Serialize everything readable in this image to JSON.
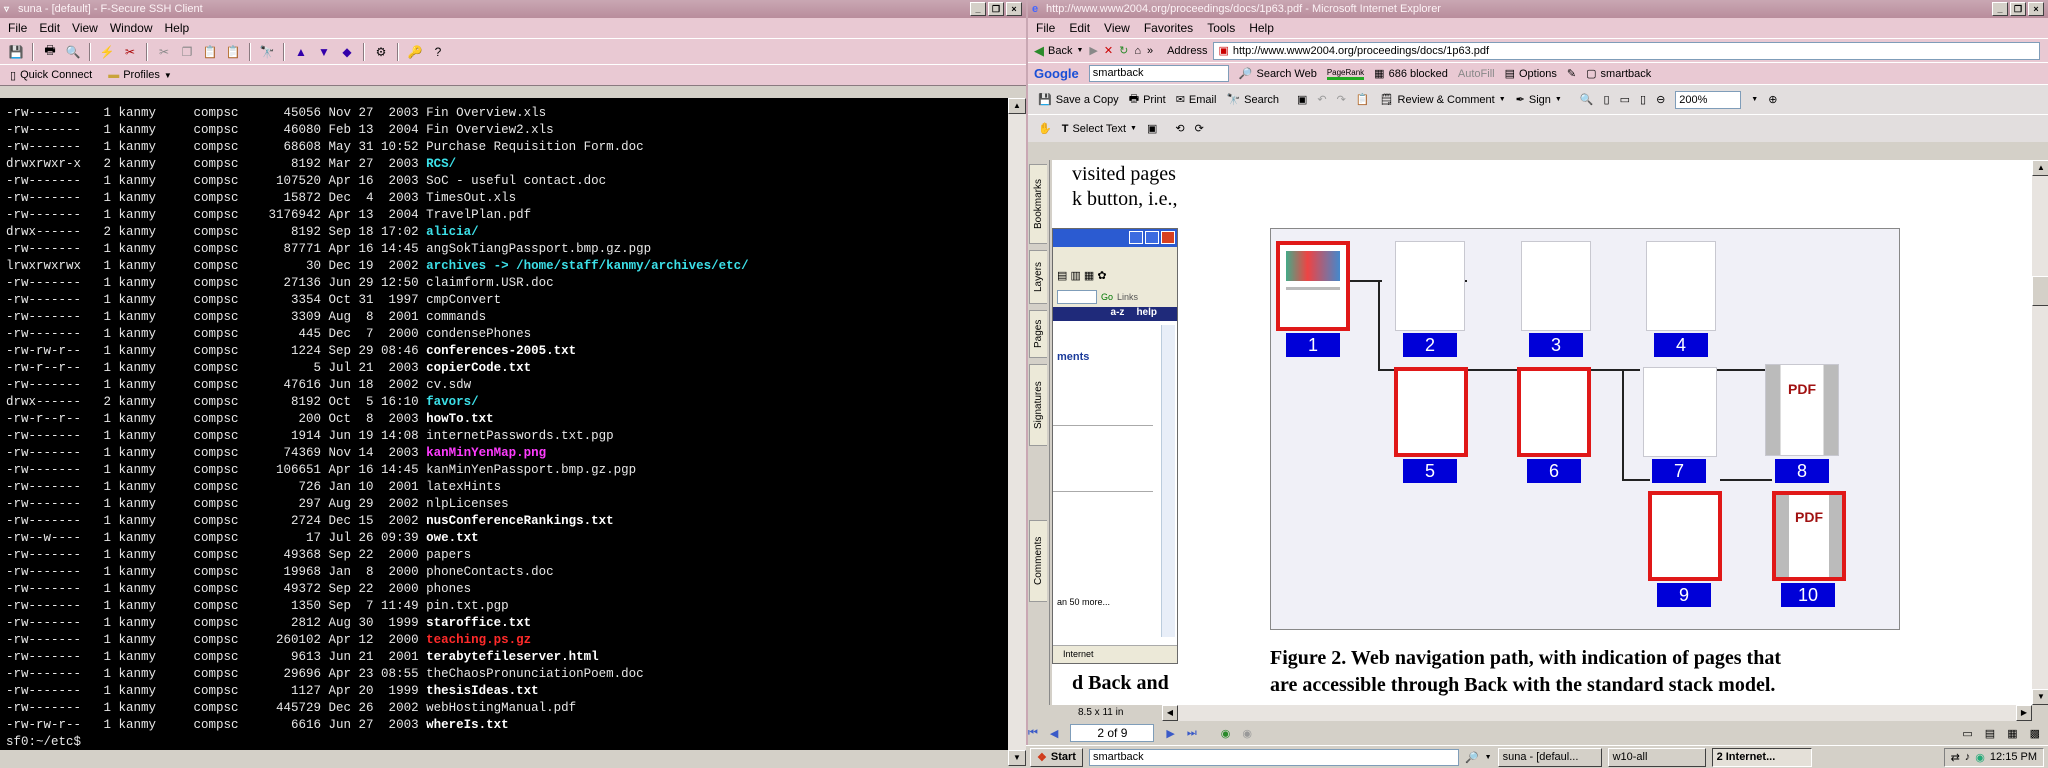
{
  "ssh": {
    "title": "suna - [default] - F-Secure SSH Client",
    "menu": [
      "File",
      "Edit",
      "View",
      "Window",
      "Help"
    ],
    "quick_connect": "Quick Connect",
    "profiles": "Profiles",
    "lines": [
      {
        "meta": "-rw-------   1 kanmy     compsc      45056 Nov 27  2003 ",
        "name": "Fin Overview.xls",
        "style": ""
      },
      {
        "meta": "-rw-------   1 kanmy     compsc      46080 Feb 13  2004 ",
        "name": "Fin Overview2.xls",
        "style": ""
      },
      {
        "meta": "-rw-------   1 kanmy     compsc      68608 May 31 10:52 ",
        "name": "Purchase Requisition Form.doc",
        "style": ""
      },
      {
        "meta": "drwxrwxr-x   2 kanmy     compsc       8192 Mar 27  2003 ",
        "name": "RCS/",
        "style": "cyan"
      },
      {
        "meta": "-rw-------   1 kanmy     compsc     107520 Apr 16  2003 ",
        "name": "SoC - useful contact.doc",
        "style": ""
      },
      {
        "meta": "-rw-------   1 kanmy     compsc      15872 Dec  4  2003 ",
        "name": "TimesOut.xls",
        "style": ""
      },
      {
        "meta": "-rw-------   1 kanmy     compsc    3176942 Apr 13  2004 ",
        "name": "TravelPlan.pdf",
        "style": ""
      },
      {
        "meta": "drwx------   2 kanmy     compsc       8192 Sep 18 17:02 ",
        "name": "alicia/",
        "style": "cyan"
      },
      {
        "meta": "-rw-------   1 kanmy     compsc      87771 Apr 16 14:45 ",
        "name": "angSokTiangPassport.bmp.gz.pgp",
        "style": ""
      },
      {
        "meta": "lrwxrwxrwx   1 kanmy     compsc         30 Dec 19  2002 ",
        "name": "archives -> /home/staff/kanmy/archives/etc/",
        "style": "cyan"
      },
      {
        "meta": "-rw-------   1 kanmy     compsc      27136 Jun 29 12:50 ",
        "name": "claimform.USR.doc",
        "style": ""
      },
      {
        "meta": "-rw-------   1 kanmy     compsc       3354 Oct 31  1997 ",
        "name": "cmpConvert",
        "style": ""
      },
      {
        "meta": "-rw-------   1 kanmy     compsc       3309 Aug  8  2001 ",
        "name": "commands",
        "style": ""
      },
      {
        "meta": "-rw-------   1 kanmy     compsc        445 Dec  7  2000 ",
        "name": "condensePhones",
        "style": ""
      },
      {
        "meta": "-rw-rw-r--   1 kanmy     compsc       1224 Sep 29 08:46 ",
        "name": "conferences-2005.txt",
        "style": "bold"
      },
      {
        "meta": "-rw-r--r--   1 kanmy     compsc          5 Jul 21  2003 ",
        "name": "copierCode.txt",
        "style": "bold"
      },
      {
        "meta": "-rw-------   1 kanmy     compsc      47616 Jun 18  2002 ",
        "name": "cv.sdw",
        "style": ""
      },
      {
        "meta": "drwx------   2 kanmy     compsc       8192 Oct  5 16:10 ",
        "name": "favors/",
        "style": "cyan"
      },
      {
        "meta": "-rw-r--r--   1 kanmy     compsc        200 Oct  8  2003 ",
        "name": "howTo.txt",
        "style": "bold"
      },
      {
        "meta": "-rw-------   1 kanmy     compsc       1914 Jun 19 14:08 ",
        "name": "internetPasswords.txt.pgp",
        "style": ""
      },
      {
        "meta": "-rw-------   1 kanmy     compsc      74369 Nov 14  2003 ",
        "name": "kanMinYenMap.png",
        "style": "mag"
      },
      {
        "meta": "-rw-------   1 kanmy     compsc     106651 Apr 16 14:45 ",
        "name": "kanMinYenPassport.bmp.gz.pgp",
        "style": ""
      },
      {
        "meta": "-rw-------   1 kanmy     compsc        726 Jan 10  2001 ",
        "name": "latexHints",
        "style": ""
      },
      {
        "meta": "-rw-------   1 kanmy     compsc        297 Aug 29  2002 ",
        "name": "nlpLicenses",
        "style": ""
      },
      {
        "meta": "-rw-------   1 kanmy     compsc       2724 Dec 15  2002 ",
        "name": "nusConferenceRankings.txt",
        "style": "bold"
      },
      {
        "meta": "-rw--w----   1 kanmy     compsc         17 Jul 26 09:39 ",
        "name": "owe.txt",
        "style": "bold"
      },
      {
        "meta": "-rw-------   1 kanmy     compsc      49368 Sep 22  2000 ",
        "name": "papers",
        "style": ""
      },
      {
        "meta": "-rw-------   1 kanmy     compsc      19968 Jan  8  2000 ",
        "name": "phoneContacts.doc",
        "style": ""
      },
      {
        "meta": "-rw-------   1 kanmy     compsc      49372 Sep 22  2000 ",
        "name": "phones",
        "style": ""
      },
      {
        "meta": "-rw-------   1 kanmy     compsc       1350 Sep  7 11:49 ",
        "name": "pin.txt.pgp",
        "style": ""
      },
      {
        "meta": "-rw-------   1 kanmy     compsc       2812 Aug 30  1999 ",
        "name": "staroffice.txt",
        "style": "bold"
      },
      {
        "meta": "-rw-------   1 kanmy     compsc     260102 Apr 12  2000 ",
        "name": "teaching.ps.gz",
        "style": "red"
      },
      {
        "meta": "-rw-------   1 kanmy     compsc       9613 Jun 21  2001 ",
        "name": "terabytefileserver.html",
        "style": "bold"
      },
      {
        "meta": "-rw-------   1 kanmy     compsc      29696 Apr 23 08:55 ",
        "name": "theChaosPronunciationPoem.doc",
        "style": ""
      },
      {
        "meta": "-rw-------   1 kanmy     compsc       1127 Apr 20  1999 ",
        "name": "thesisIdeas.txt",
        "style": "bold"
      },
      {
        "meta": "-rw-------   1 kanmy     compsc     445729 Dec 26  2002 ",
        "name": "webHostingManual.pdf",
        "style": ""
      },
      {
        "meta": "-rw-rw-r--   1 kanmy     compsc       6616 Jun 27  2003 ",
        "name": "whereIs.txt",
        "style": "bold"
      }
    ],
    "prompt": "sf0:~/etc$"
  },
  "ie": {
    "title": "http://www.www2004.org/proceedings/docs/1p63.pdf - Microsoft Internet Explorer",
    "menu": [
      "File",
      "Edit",
      "View",
      "Favorites",
      "Tools",
      "Help"
    ],
    "back": "Back",
    "address_label": "Address",
    "address": "http://www.www2004.org/proceedings/docs/1p63.pdf",
    "google": {
      "logo": "Google",
      "query": "smartback",
      "search_web": "Search Web",
      "pagerank": "PageRank",
      "blocked": "686 blocked",
      "autofill": "AutoFill",
      "options": "Options",
      "term": "smartback"
    },
    "pdf_toolbar": {
      "save_copy": "Save a Copy",
      "print": "Print",
      "email": "Email",
      "search": "Search",
      "review": "Review & Comment",
      "sign": "Sign",
      "zoom": "200%",
      "select_text": "Select Text"
    },
    "side_tabs": [
      "Bookmarks",
      "Layers",
      "Pages",
      "Signatures",
      "Comments"
    ],
    "page": {
      "left_line1": "visited pages",
      "left_line2": "k button, i.e.,",
      "left_bottom": "d  Back  and",
      "pdf_label": "PDF",
      "caption_line1": "Figure 2.  Web navigation path, with indication of pages that",
      "caption_line2": "are accessible through Back with the standard stack model.",
      "embedded": {
        "go": "Go",
        "links": "Links",
        "az": "a-z",
        "help": "help",
        "ments": "ments",
        "more": "an 50 more...",
        "internet": "Internet"
      },
      "nodes": [
        "1",
        "2",
        "3",
        "4",
        "5",
        "6",
        "7",
        "8",
        "9",
        "10"
      ]
    },
    "page_size": "8.5 x 11 in",
    "page_nav": "2 of 9"
  },
  "taskbar": {
    "start": "Start",
    "search": "smartback",
    "tasks": [
      "suna - [defaul...",
      "w10-all",
      "2 Internet..."
    ],
    "clock": "12:15 PM"
  }
}
